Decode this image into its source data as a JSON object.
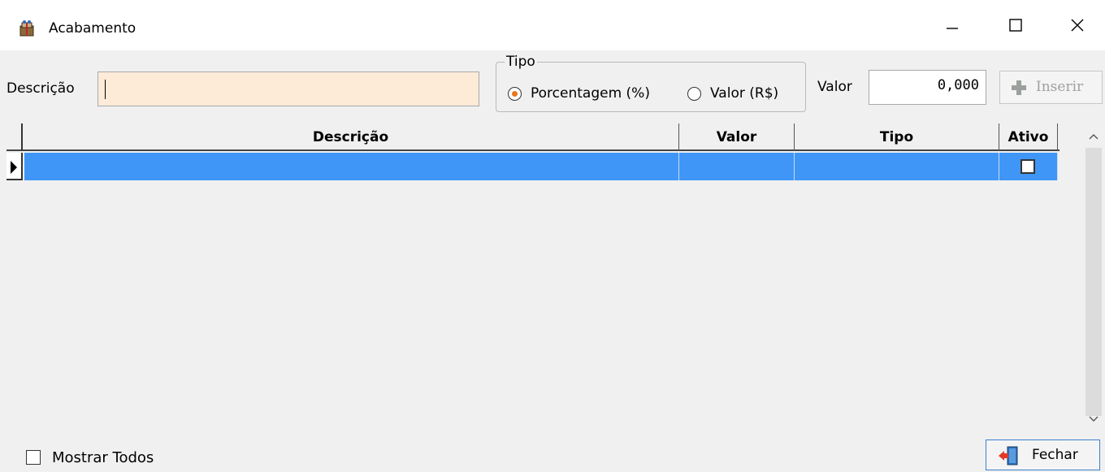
{
  "window": {
    "title": "Acabamento",
    "icon": "box-gift-icon"
  },
  "form": {
    "descricao_label": "Descrição",
    "descricao_value": "",
    "tipo_legend": "Tipo",
    "tipo_options": [
      {
        "label": "Porcentagem (%)",
        "checked": true
      },
      {
        "label": "Valor (R$)",
        "checked": false
      }
    ],
    "valor_label": "Valor",
    "valor_value": "0,000",
    "inserir_label": "Inserir"
  },
  "grid": {
    "columns": [
      "Descrição",
      "Valor",
      "Tipo",
      "Ativo"
    ],
    "rows": [
      {
        "descricao": "",
        "valor": "",
        "tipo": "",
        "ativo": false,
        "selected": true
      }
    ]
  },
  "footer": {
    "mostrar_todos_label": "Mostrar Todos",
    "mostrar_todos_checked": false,
    "fechar_label": "Fechar"
  },
  "colors": {
    "input_highlight": "#fdebd7",
    "selected_row": "#3f96f7",
    "radio_dot": "#e6781e"
  }
}
